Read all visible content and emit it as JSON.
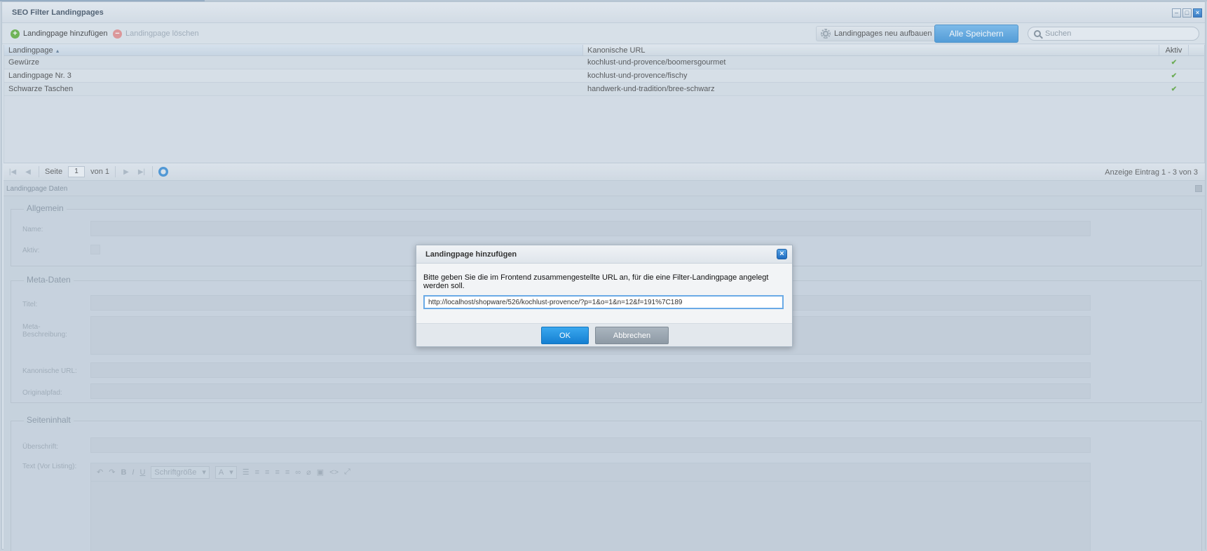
{
  "window": {
    "title": "SEO Filter Landingpages"
  },
  "toolbar": {
    "add_label": "Landingpage hinzufügen",
    "delete_label": "Landingpage löschen",
    "rebuild_label": "Landingpages neu aufbauen",
    "save_all_label": "Alle Speichern",
    "search_placeholder": "Suchen"
  },
  "grid": {
    "columns": [
      "Landingpage",
      "Kanonische URL",
      "Aktiv"
    ],
    "rows": [
      {
        "landingpage": "Gewürze",
        "url": "kochlust-und-provence/boomersgourmet",
        "active": "✔"
      },
      {
        "landingpage": "Landingpage Nr. 3",
        "url": "kochlust-und-provence/fischy",
        "active": "✔"
      },
      {
        "landingpage": "Schwarze Taschen",
        "url": "handwerk-und-tradition/bree-schwarz",
        "active": "✔"
      }
    ]
  },
  "pager": {
    "page_label": "Seite",
    "page_value": "1",
    "of_label": "von 1",
    "summary": "Anzeige Eintrag 1 - 3 von 3"
  },
  "detail": {
    "title": "Landingpage Daten",
    "general": {
      "legend": "Allgemein",
      "name_label": "Name:",
      "active_label": "Aktiv:"
    },
    "meta": {
      "legend": "Meta-Daten",
      "title_label": "Titel:",
      "description_label_1": "Meta-",
      "description_label_2": "Beschreibung:",
      "canonical_label": "Kanonische URL:",
      "origin_label": "Originalpfad:"
    },
    "content": {
      "legend": "Seiteninhalt",
      "heading_label": "Überschrift:",
      "text_label": "Text (Vor Listing):",
      "fontsize_label": "Schriftgröße"
    }
  },
  "dialog": {
    "title": "Landingpage hinzufügen",
    "message": "Bitte geben Sie die im Frontend zusammengestellte URL an, für die eine Filter-Landingpage angelegt werden soll.",
    "url_value": "http://localhost/shopware/526/kochlust-provence/?p=1&o=1&n=12&f=191%7C189",
    "ok_label": "OK",
    "cancel_label": "Abbrechen"
  }
}
